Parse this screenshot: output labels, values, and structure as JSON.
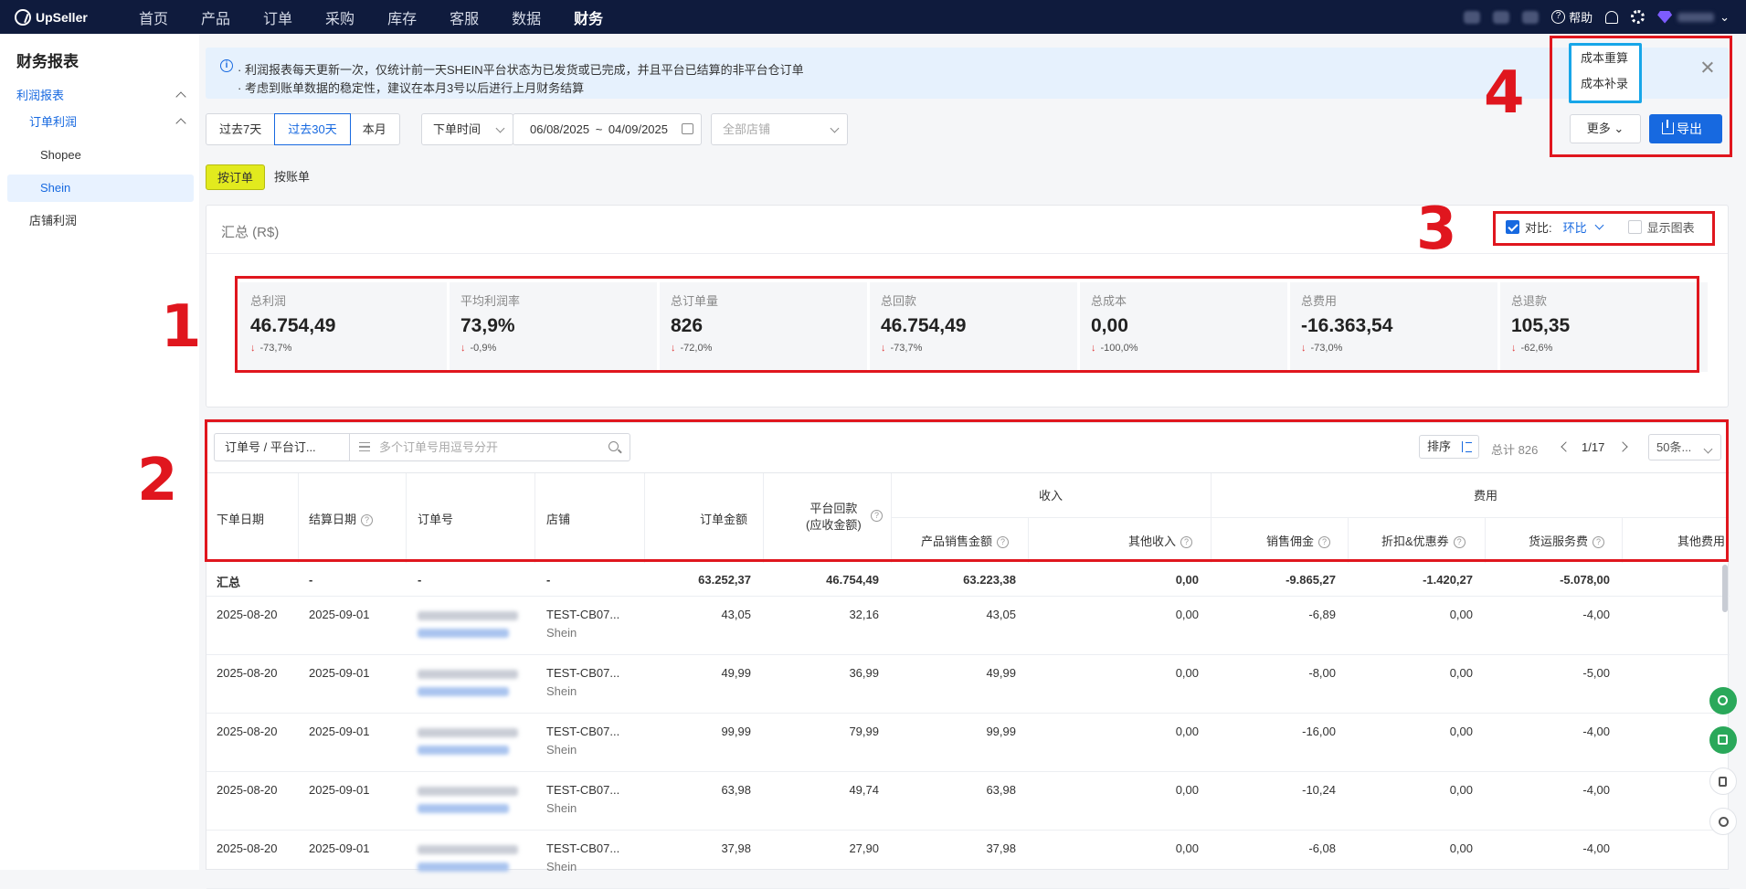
{
  "topbar": {
    "brand": "UpSeller",
    "nav": [
      "首页",
      "产品",
      "订单",
      "采购",
      "库存",
      "客服",
      "数据",
      "财务"
    ],
    "active_nav": "财务",
    "help_label": "帮助"
  },
  "sidebar": {
    "title": "财务报表",
    "items": [
      {
        "label": "利润报表",
        "level": 1,
        "expanded": true
      },
      {
        "label": "订单利润",
        "level": 2,
        "expanded": true
      },
      {
        "label": "Shopee",
        "level": 3
      },
      {
        "label": "Shein",
        "level": 3,
        "selected": true
      },
      {
        "label": "店铺利润",
        "level": 2
      }
    ]
  },
  "notice": {
    "line1": "· 利润报表每天更新一次，仅统计前一天SHEIN平台状态为已发货或已完成，并且平台已结算的非平台仓订单",
    "line2": "· 考虑到账单数据的稳定性，建议在本月3号以后进行上月财务结算"
  },
  "filters": {
    "ranges": [
      "过去7天",
      "过去30天",
      "本月"
    ],
    "active_range": "过去30天",
    "time_type": "下单时间",
    "date_start": "06/08/2025",
    "date_sep": "~",
    "date_end": "04/09/2025",
    "store_placeholder": "全部店铺"
  },
  "actions": {
    "more_label": "更多",
    "export_label": "导出",
    "more_menu": [
      "成本重算",
      "成本补录"
    ]
  },
  "view_tabs": [
    "按订单",
    "按账单"
  ],
  "active_view": "按订单",
  "summary": {
    "title": "汇总 (R$)",
    "compare_label": "对比:",
    "compare_value": "环比",
    "compare_checked": true,
    "show_chart_label": "显示图表",
    "show_chart_checked": false,
    "kpis": [
      {
        "label": "总利润",
        "value": "46.754,49",
        "change": "-73,7%"
      },
      {
        "label": "平均利润率",
        "value": "73,9%",
        "change": "-0,9%"
      },
      {
        "label": "总订单量",
        "value": "826",
        "change": "-72,0%"
      },
      {
        "label": "总回款",
        "value": "46.754,49",
        "change": "-73,7%"
      },
      {
        "label": "总成本",
        "value": "0,00",
        "change": "-100,0%"
      },
      {
        "label": "总费用",
        "value": "-16.363,54",
        "change": "-73,0%"
      },
      {
        "label": "总退款",
        "value": "105,35",
        "change": "-62,6%"
      }
    ],
    "change_arrow": "↓"
  },
  "table": {
    "search_type": "订单号 / 平台订...",
    "search_placeholder": "多个订单号用逗号分开",
    "sort_label": "排序",
    "total_label": "总计 826",
    "page": "1/17",
    "page_size": "50条...",
    "headers": {
      "order_date": "下单日期",
      "settle_date": "结算日期",
      "order_no": "订单号",
      "store": "店铺",
      "order_amount": "订单金额",
      "platform_payout_1": "平台回款",
      "platform_payout_2": "(应收金额)",
      "income_group": "收入",
      "fee_group": "费用",
      "product_sales": "产品销售金额",
      "other_income": "其他收入",
      "commission": "销售佣金",
      "discount": "折扣&优惠券",
      "shipping_fee": "货运服务费",
      "other_fee": "其他费用"
    },
    "total_row": {
      "label": "汇总",
      "settle": "-",
      "order": "-",
      "store": "-",
      "order_amount": "63.252,37",
      "payout": "46.754,49",
      "product_sales": "63.223,38",
      "other_income": "0,00",
      "commission": "-9.865,27",
      "discount": "-1.420,27",
      "shipping": "-5.078,00"
    },
    "rows": [
      {
        "order_date": "2025-08-20",
        "settle_date": "2025-09-01",
        "store": "TEST-CB07...",
        "platform": "Shein",
        "order_amount": "43,05",
        "payout": "32,16",
        "product_sales": "43,05",
        "other_income": "0,00",
        "commission": "-6,89",
        "discount": "0,00",
        "shipping": "-4,00"
      },
      {
        "order_date": "2025-08-20",
        "settle_date": "2025-09-01",
        "store": "TEST-CB07...",
        "platform": "Shein",
        "order_amount": "49,99",
        "payout": "36,99",
        "product_sales": "49,99",
        "other_income": "0,00",
        "commission": "-8,00",
        "discount": "0,00",
        "shipping": "-5,00"
      },
      {
        "order_date": "2025-08-20",
        "settle_date": "2025-09-01",
        "store": "TEST-CB07...",
        "platform": "Shein",
        "order_amount": "99,99",
        "payout": "79,99",
        "product_sales": "99,99",
        "other_income": "0,00",
        "commission": "-16,00",
        "discount": "0,00",
        "shipping": "-4,00"
      },
      {
        "order_date": "2025-08-20",
        "settle_date": "2025-09-01",
        "store": "TEST-CB07...",
        "platform": "Shein",
        "order_amount": "63,98",
        "payout": "49,74",
        "product_sales": "63,98",
        "other_income": "0,00",
        "commission": "-10,24",
        "discount": "0,00",
        "shipping": "-4,00"
      },
      {
        "order_date": "2025-08-20",
        "settle_date": "2025-09-01",
        "store": "TEST-CB07...",
        "platform": "Shein",
        "order_amount": "37,98",
        "payout": "27,90",
        "product_sales": "37,98",
        "other_income": "0,00",
        "commission": "-6,08",
        "discount": "0,00",
        "shipping": "-4,00"
      }
    ]
  },
  "annotations": {
    "labels": [
      "1",
      "2",
      "3",
      "4"
    ],
    "highlight_color": "#e0161e",
    "menu_highlight_color": "#17a6e8"
  },
  "colors": {
    "topbar": "#0f1b3d",
    "accent": "#1769e0",
    "active_tab": "#e2ea1e",
    "down": "#e03a3a",
    "fab_green": "#2aa85a"
  },
  "icons": [
    "info-icon",
    "close-icon",
    "calendar-icon",
    "download-icon",
    "search-icon",
    "sort-icon",
    "help-icon",
    "bell-icon",
    "gear-icon",
    "chevron-down-icon"
  ]
}
